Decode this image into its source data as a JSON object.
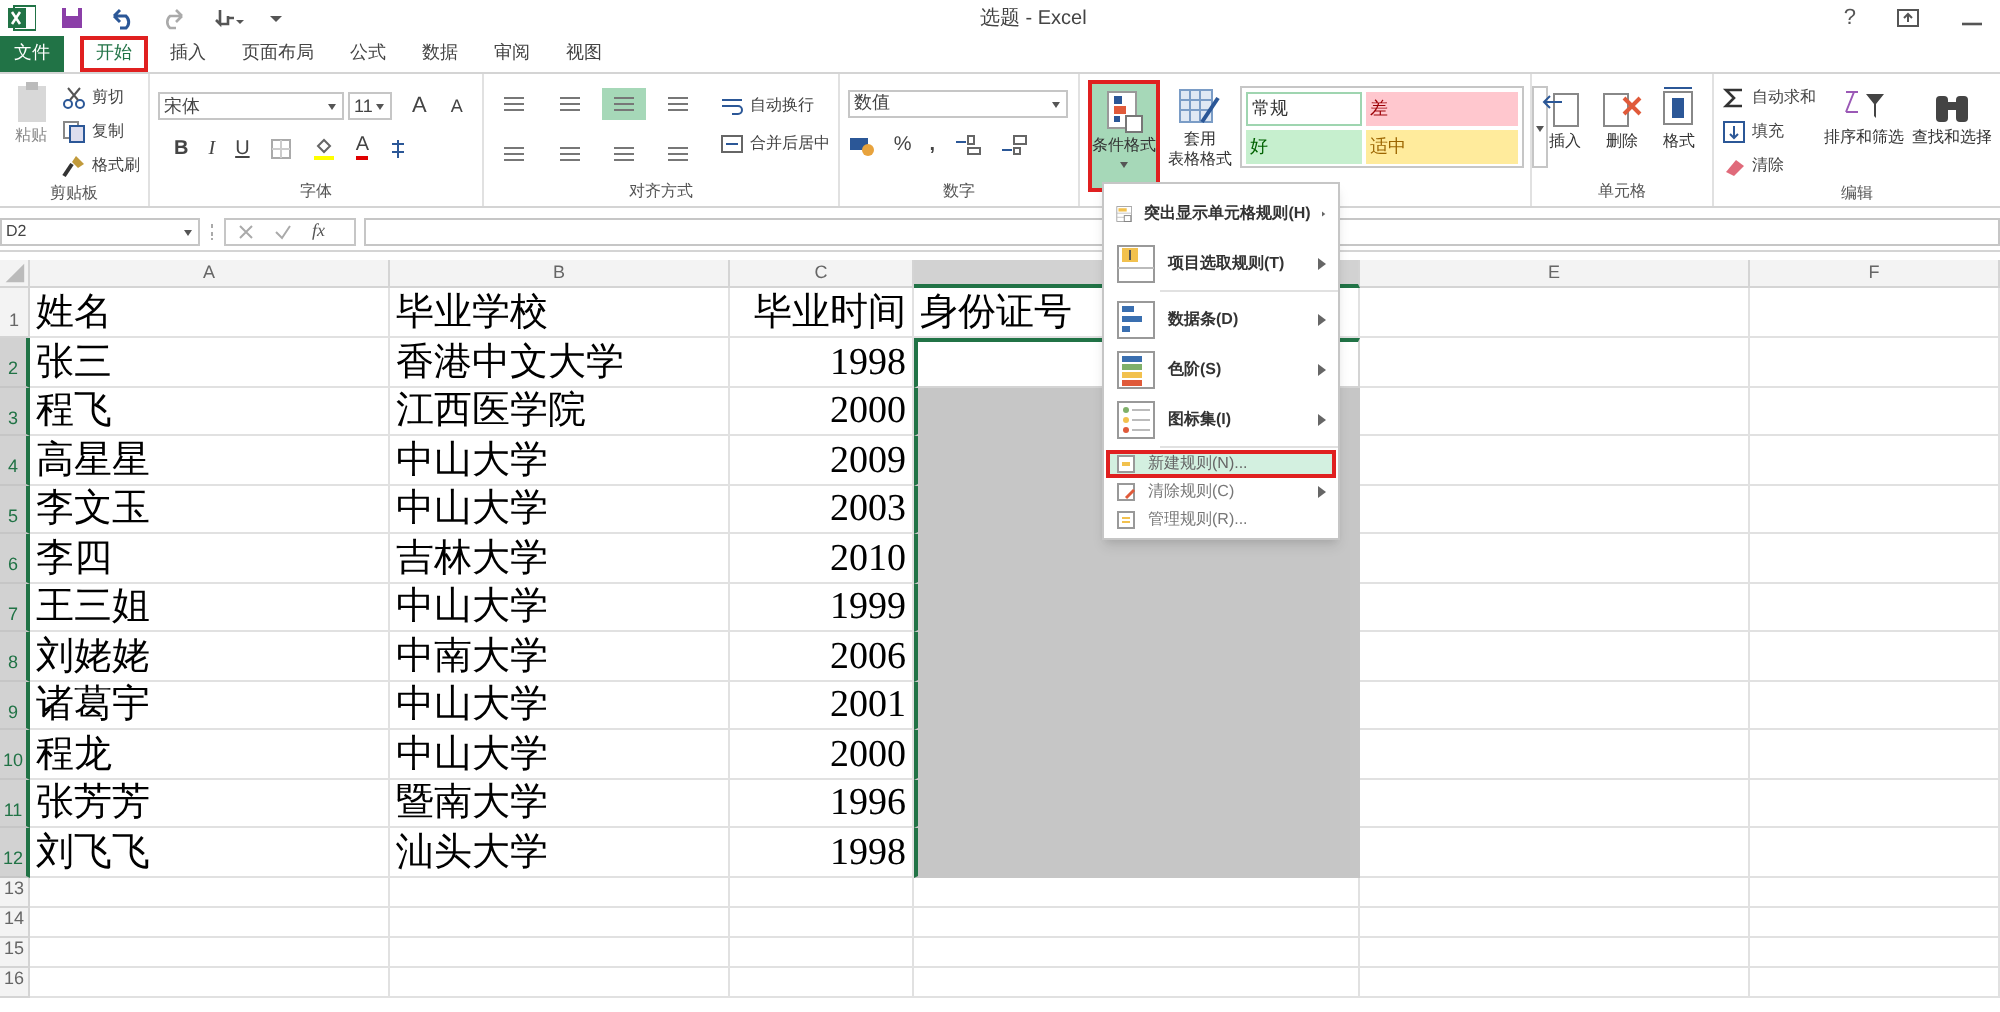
{
  "window": {
    "title": "选题 - Excel",
    "help": "?"
  },
  "tabs": [
    {
      "label": "文件",
      "kind": "file",
      "selected": false
    },
    {
      "label": "开始",
      "kind": "tab",
      "selected": true
    },
    {
      "label": "插入",
      "kind": "tab",
      "selected": false
    },
    {
      "label": "页面布局",
      "kind": "tab",
      "selected": false
    },
    {
      "label": "公式",
      "kind": "tab",
      "selected": false
    },
    {
      "label": "数据",
      "kind": "tab",
      "selected": false
    },
    {
      "label": "审阅",
      "kind": "tab",
      "selected": false
    },
    {
      "label": "视图",
      "kind": "tab",
      "selected": false
    }
  ],
  "ribbon": {
    "clipboard": {
      "label": "剪贴板",
      "paste": "粘贴",
      "cut": "剪切",
      "copy": "复制",
      "painter": "格式刷"
    },
    "font": {
      "label": "字体",
      "font_name": "宋体",
      "font_size": "11",
      "grow": "A",
      "shrink": "A",
      "bold": "B",
      "italic": "I",
      "underline": "U",
      "font_color": "A"
    },
    "alignment": {
      "label": "对齐方式",
      "wrap": "自动换行",
      "merge": "合并后居中"
    },
    "number": {
      "label": "数字",
      "format": "数值",
      "percent": "%",
      "comma": ","
    },
    "styles": {
      "conditional": "条件格式",
      "conditional_open": true,
      "table_lines": [
        "套用",
        "表格格式"
      ],
      "cell_styles": [
        {
          "label": "常规",
          "color": "#ffffff"
        },
        {
          "label": "差",
          "color": "#ffc7ce"
        },
        {
          "label": "好",
          "color": "#c6efce"
        },
        {
          "label": "适中",
          "color": "#ffeb9c"
        }
      ]
    },
    "cells": {
      "label": "单元格",
      "insert": "插入",
      "delete": "删除",
      "format": "格式"
    },
    "editing": {
      "label": "编辑",
      "autosum": "自动求和",
      "fill": "填充",
      "clear": "清除",
      "sort": "排序和筛选",
      "find": "查找和选择"
    }
  },
  "formula_bar": {
    "name_box": "D2",
    "fx": "fx"
  },
  "sheet": {
    "columns": [
      {
        "label": "A",
        "selected": false
      },
      {
        "label": "B",
        "selected": false
      },
      {
        "label": "C",
        "selected": false
      },
      {
        "selected": true
      },
      {
        "label": "E",
        "selected": false
      },
      {
        "label": "F",
        "selected": false
      }
    ],
    "rows": [
      {
        "number": "1",
        "selected": false,
        "cells": [
          "姓名",
          "毕业学校",
          "毕业时间",
          "身份证号"
        ]
      },
      {
        "number": "2",
        "selected": true,
        "cells": [
          "张三",
          "香港中文大学",
          "1998",
          ""
        ]
      },
      {
        "number": "3",
        "selected": true,
        "cells": [
          "程飞",
          "江西医学院",
          "2000",
          ""
        ]
      },
      {
        "number": "4",
        "selected": true,
        "cells": [
          "高星星",
          "中山大学",
          "2009",
          ""
        ]
      },
      {
        "number": "5",
        "selected": true,
        "cells": [
          "李文玉",
          "中山大学",
          "2003",
          ""
        ]
      },
      {
        "number": "6",
        "selected": true,
        "cells": [
          "李四",
          "吉林大学",
          "2010",
          ""
        ]
      },
      {
        "number": "7",
        "selected": true,
        "cells": [
          "王三姐",
          "中山大学",
          "1999",
          ""
        ]
      },
      {
        "number": "8",
        "selected": true,
        "cells": [
          "刘姥姥",
          "中南大学",
          "2006",
          ""
        ]
      },
      {
        "number": "9",
        "selected": true,
        "cells": [
          "诸葛宇",
          "中山大学",
          "2001",
          ""
        ]
      },
      {
        "number": "10",
        "selected": true,
        "cells": [
          "程龙",
          "中山大学",
          "2000",
          ""
        ]
      },
      {
        "number": "11",
        "selected": true,
        "cells": [
          "张芳芳",
          "暨南大学",
          "1996",
          ""
        ]
      },
      {
        "number": "12",
        "selected": true,
        "cells": [
          "刘飞飞",
          "汕头大学",
          "1998",
          ""
        ]
      },
      {
        "number": "13",
        "selected": false,
        "cells": []
      },
      {
        "number": "14",
        "selected": false,
        "cells": []
      },
      {
        "number": "15",
        "selected": false,
        "cells": []
      },
      {
        "number": "16",
        "selected": false,
        "cells": []
      }
    ]
  },
  "menu": {
    "items": [
      {
        "label": "突出显示单元格规则(H)",
        "kind": "large",
        "submenu": true,
        "selected": false
      },
      {
        "label": "项目选取规则(T)",
        "kind": "large",
        "submenu": true,
        "selected": false
      },
      {
        "label": "数据条(D)",
        "kind": "large",
        "submenu": true,
        "selected": false
      },
      {
        "label": "色阶(S)",
        "kind": "large",
        "submenu": true,
        "selected": false
      },
      {
        "label": "图标集(I)",
        "kind": "large",
        "submenu": true,
        "selected": false
      },
      {
        "label": "新建规则(N)...",
        "kind": "small",
        "submenu": false,
        "selected": true
      },
      {
        "label": "清除规则(C)",
        "kind": "small",
        "submenu": true,
        "selected": false
      },
      {
        "label": "管理规则(R)...",
        "kind": "small",
        "submenu": false,
        "selected": false
      }
    ]
  }
}
